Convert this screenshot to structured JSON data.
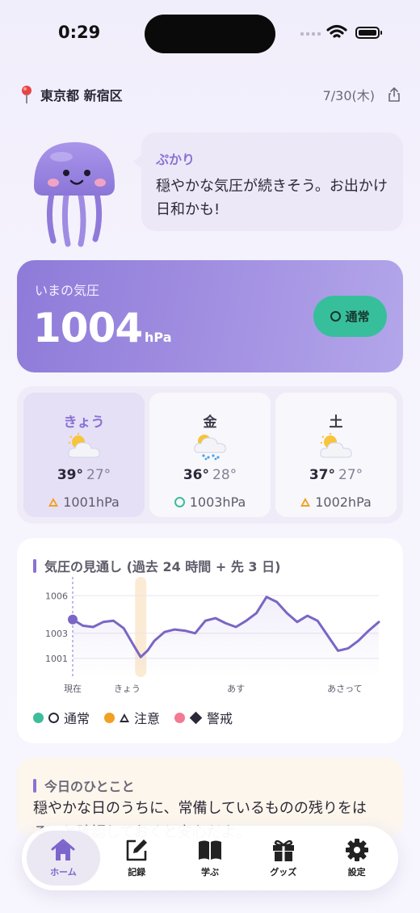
{
  "status_bar": {
    "time": "0:29"
  },
  "header": {
    "location": "東京都 新宿区",
    "date": "7/30(木)"
  },
  "mascot": {
    "name": "ぷかり",
    "message": "穏やかな気圧が続きそう。お出かけ日和かも!"
  },
  "current": {
    "label": "いまの気圧",
    "value": "1004",
    "unit": "hPa",
    "status": "通常"
  },
  "forecast": [
    {
      "day": "きょう",
      "weather_icon": "sun-behind-cloud-icon",
      "high": "39°",
      "low": "27°",
      "pressure": "1001hPa",
      "level": "caution"
    },
    {
      "day": "金",
      "weather_icon": "sun-behind-rain-cloud-icon",
      "high": "36°",
      "low": "28°",
      "pressure": "1003hPa",
      "level": "normal"
    },
    {
      "day": "土",
      "weather_icon": "sun-behind-cloud-icon",
      "high": "37°",
      "low": "27°",
      "pressure": "1002hPa",
      "level": "caution"
    }
  ],
  "chart_data": {
    "type": "line",
    "title": "気圧の見通し (過去 24 時間 + 先 3 日)",
    "ytick_labels": [
      "1006",
      "1003",
      "1001"
    ],
    "yticks": [
      1006,
      1003,
      1001
    ],
    "ylim": [
      999.5,
      1007.5
    ],
    "xtick_labels": [
      "現在",
      "きょう",
      "あす",
      "あさって"
    ],
    "xticks": [
      0,
      16,
      48,
      80
    ],
    "xlim": [
      0,
      90
    ],
    "highlight_band": 20,
    "series": [
      {
        "color": "#7a66c4",
        "x": [
          0,
          3,
          6,
          9,
          12,
          15,
          18,
          20,
          22,
          24,
          27,
          30,
          33,
          36,
          39,
          42,
          45,
          48,
          51,
          54,
          57,
          60,
          63,
          66,
          69,
          72,
          75,
          78,
          81,
          84,
          87,
          90
        ],
        "values": [
          1004.1,
          1003.6,
          1003.5,
          1003.9,
          1004.0,
          1003.4,
          1002.0,
          1001.1,
          1001.6,
          1002.4,
          1003.1,
          1003.3,
          1003.2,
          1003.0,
          1004.0,
          1004.2,
          1003.8,
          1003.5,
          1004.0,
          1004.6,
          1005.9,
          1005.5,
          1004.6,
          1003.9,
          1004.4,
          1004.0,
          1002.8,
          1001.6,
          1001.8,
          1002.4,
          1003.2,
          1003.9
        ]
      }
    ]
  },
  "legend": [
    {
      "color": "#3dbd9a",
      "label": "通常"
    },
    {
      "color": "#f0a023",
      "label": "注意"
    },
    {
      "color": "#f27a92",
      "label": "警戒"
    }
  ],
  "hint": {
    "title": "今日のひとこと",
    "text": "穏やかな日のうちに、常備しているものの残りをはる。と確認しておくと安心だよ。"
  },
  "tabs": [
    {
      "label": "ホーム",
      "icon": "home-icon",
      "active": true
    },
    {
      "label": "記録",
      "icon": "edit-icon"
    },
    {
      "label": "学ぶ",
      "icon": "book-icon"
    },
    {
      "label": "グッズ",
      "icon": "gift-icon"
    },
    {
      "label": "設定",
      "icon": "gear-icon"
    }
  ],
  "colors": {
    "accent": "#8a72d4",
    "normal": "#3dbd9a",
    "caution": "#f0a023",
    "warning": "#f27a92"
  }
}
